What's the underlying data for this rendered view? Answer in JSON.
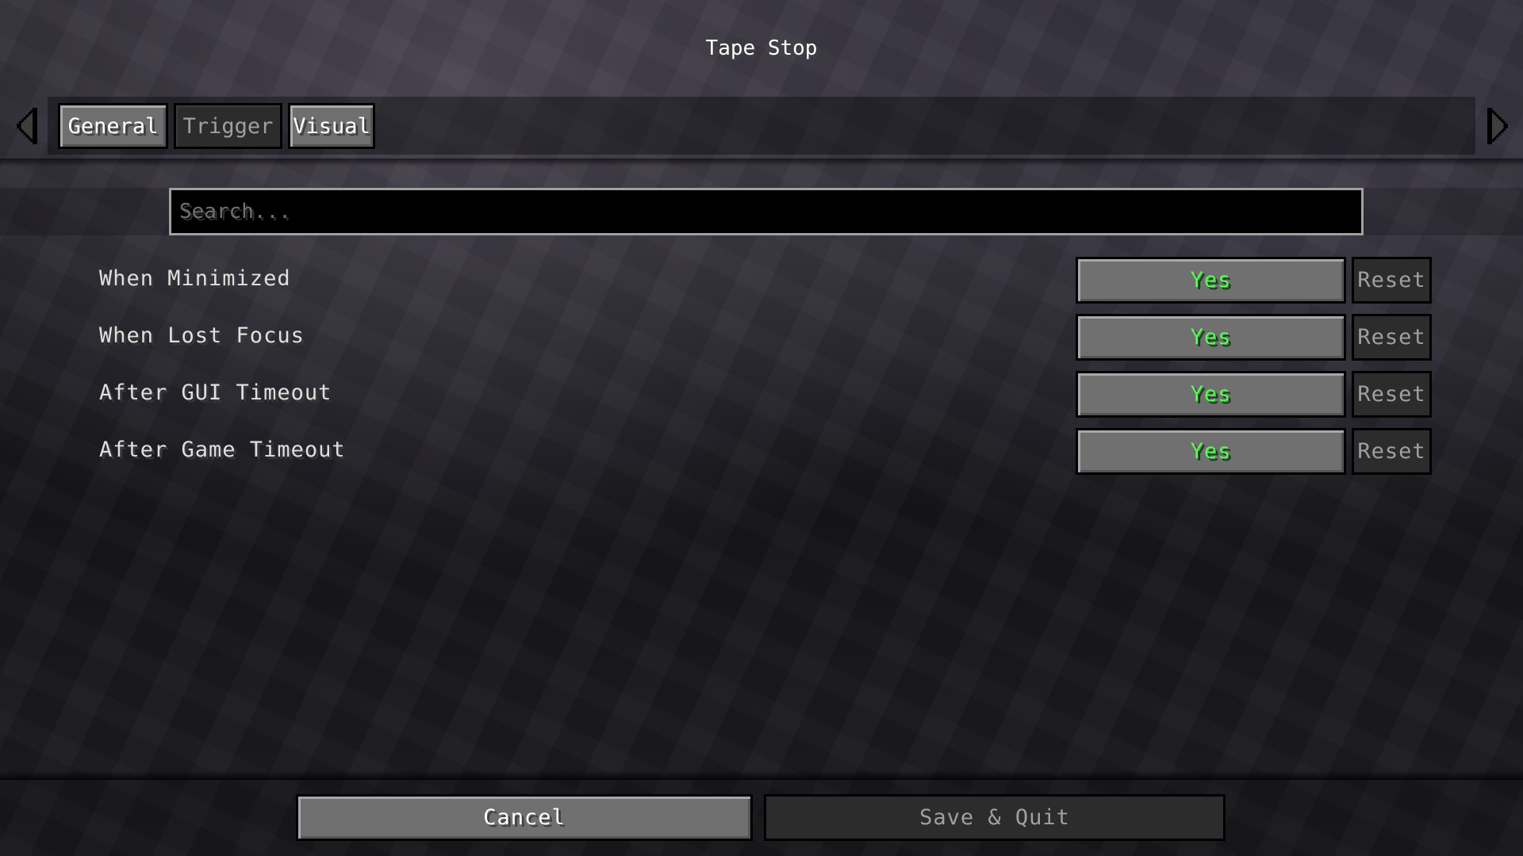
{
  "screen": {
    "title": "Tape Stop"
  },
  "tabs": [
    {
      "label": "General",
      "state": "active"
    },
    {
      "label": "Trigger",
      "state": "disabled"
    },
    {
      "label": "Visual",
      "state": "active"
    }
  ],
  "nav": {
    "prev_icon": "arrow-left-icon",
    "next_icon": "arrow-right-icon"
  },
  "search": {
    "placeholder": "Search...",
    "value": ""
  },
  "options": [
    {
      "label": "When Minimized",
      "value": "Yes",
      "reset_label": "Reset"
    },
    {
      "label": "When Lost Focus",
      "value": "Yes",
      "reset_label": "Reset"
    },
    {
      "label": "After GUI Timeout",
      "value": "Yes",
      "reset_label": "Reset"
    },
    {
      "label": "After Game Timeout",
      "value": "Yes",
      "reset_label": "Reset"
    }
  ],
  "footer": {
    "cancel_label": "Cancel",
    "save_label": "Save & Quit"
  },
  "colors": {
    "yes_text": "#55ff55",
    "disabled_text": "#a0a0a0",
    "button_bg": "#707070"
  }
}
